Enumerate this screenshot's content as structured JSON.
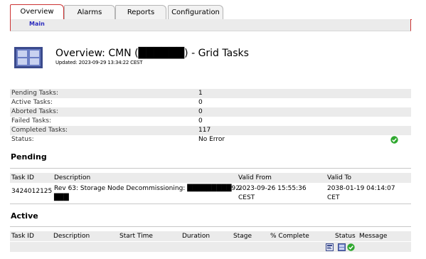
{
  "tabs": [
    {
      "label": "Overview",
      "active": true
    },
    {
      "label": "Alarms",
      "active": false
    },
    {
      "label": "Reports",
      "active": false
    },
    {
      "label": "Configuration",
      "active": false
    }
  ],
  "subnav": {
    "main_label": "Main"
  },
  "header": {
    "title": "Overview: CMN (██████) - Grid Tasks",
    "updated": "Updated: 2023-09-29 13:34:22 CEST"
  },
  "summary": [
    {
      "label": "Pending Tasks:",
      "value": "1"
    },
    {
      "label": "Active Tasks:",
      "value": "0"
    },
    {
      "label": "Aborted Tasks:",
      "value": "0"
    },
    {
      "label": "Failed Tasks:",
      "value": "0"
    },
    {
      "label": "Completed Tasks:",
      "value": "117"
    },
    {
      "label": "Status:",
      "value": "No Error"
    }
  ],
  "pending": {
    "title": "Pending",
    "columns": [
      "Task ID",
      "Description",
      "Valid From",
      "Valid To"
    ],
    "rows": [
      {
        "task_id": "3424012125",
        "description_line1": "Rev 63: Storage Node Decommissioning: █████████92-",
        "description_line2": "███",
        "valid_from_line1": "2023-09-26 15:55:36",
        "valid_from_line2": "CEST",
        "valid_to_line1": "2038-01-19 04:14:07",
        "valid_to_line2": "CET"
      }
    ]
  },
  "active": {
    "title": "Active",
    "columns": [
      "Task ID",
      "Description",
      "Start Time",
      "Duration",
      "Stage",
      "% Complete",
      "Status",
      "Message"
    ],
    "status_icons": [
      "report-icon",
      "chart-icon",
      "ok-status-icon"
    ]
  },
  "colors": {
    "accent": "#cc3333",
    "shade": "#ebebeb",
    "ok": "#2fa82f",
    "link": "#2b2bbd"
  }
}
